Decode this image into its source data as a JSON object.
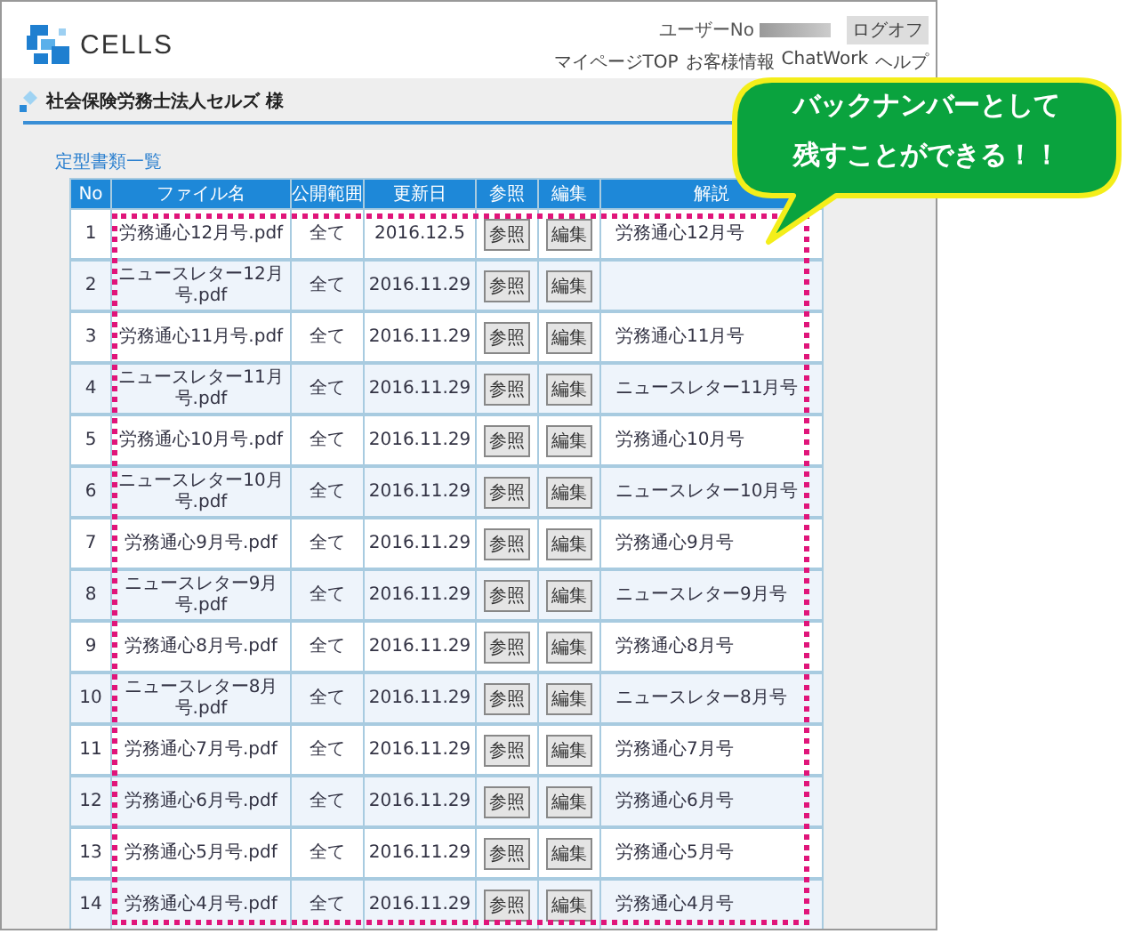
{
  "header": {
    "logo": "CELLS",
    "user_label": "ユーザーNo",
    "logout": "ログオフ",
    "nav": [
      "マイページTOP",
      "お客様情報",
      "ChatWork",
      "ヘルプ"
    ]
  },
  "client_name": "社会保険労務士法人セルズ 様",
  "section_title": "定型書類一覧",
  "table": {
    "columns": [
      "No",
      "ファイル名",
      "公開範囲",
      "更新日",
      "参照",
      "編集",
      "解説"
    ],
    "rows": [
      {
        "no": "1",
        "file": "労務通心12月号.pdf",
        "scope": "全て",
        "updated": "2016.12.5",
        "view": "参照",
        "edit": "編集",
        "note": "労務通心12月号"
      },
      {
        "no": "2",
        "file": "ニュースレター12月号.pdf",
        "scope": "全て",
        "updated": "2016.11.29",
        "view": "参照",
        "edit": "編集"
      },
      {
        "no": "3",
        "file": "労務通心11月号.pdf",
        "scope": "全て",
        "updated": "2016.11.29",
        "view": "参照",
        "edit": "編集",
        "note": "労務通心11月号"
      },
      {
        "no": "4",
        "file": "ニュースレター11月号.pdf",
        "scope": "全て",
        "updated": "2016.11.29",
        "view": "参照",
        "edit": "編集",
        "note": "ニュースレター11月号"
      },
      {
        "no": "5",
        "file": "労務通心10月号.pdf",
        "scope": "全て",
        "updated": "2016.11.29",
        "view": "参照",
        "edit": "編集",
        "note": "労務通心10月号"
      },
      {
        "no": "6",
        "file": "ニュースレター10月号.pdf",
        "scope": "全て",
        "updated": "2016.11.29",
        "view": "参照",
        "edit": "編集",
        "note": "ニュースレター10月号"
      },
      {
        "no": "7",
        "file": "労務通心9月号.pdf",
        "scope": "全て",
        "updated": "2016.11.29",
        "view": "参照",
        "edit": "編集",
        "note": "労務通心9月号"
      },
      {
        "no": "8",
        "file": "ニュースレター9月号.pdf",
        "scope": "全て",
        "updated": "2016.11.29",
        "view": "参照",
        "edit": "編集",
        "note": "ニュースレター9月号"
      },
      {
        "no": "9",
        "file": "労務通心8月号.pdf",
        "scope": "全て",
        "updated": "2016.11.29",
        "view": "参照",
        "edit": "編集",
        "note": "労務通心8月号"
      },
      {
        "no": "10",
        "file": "ニュースレター8月号.pdf",
        "scope": "全て",
        "updated": "2016.11.29",
        "view": "参照",
        "edit": "編集",
        "note": "ニュースレター8月号"
      },
      {
        "no": "11",
        "file": "労務通心7月号.pdf",
        "scope": "全て",
        "updated": "2016.11.29",
        "view": "参照",
        "edit": "編集",
        "note": "労務通心7月号"
      },
      {
        "no": "12",
        "file": "労務通心6月号.pdf",
        "scope": "全て",
        "updated": "2016.11.29",
        "view": "参照",
        "edit": "編集",
        "note": "労務通心6月号"
      },
      {
        "no": "13",
        "file": "労務通心5月号.pdf",
        "scope": "全て",
        "updated": "2016.11.29",
        "view": "参照",
        "edit": "編集",
        "note": "労務通心5月号"
      },
      {
        "no": "14",
        "file": "労務通心4月号.pdf",
        "scope": "全て",
        "updated": "2016.11.29",
        "view": "参照",
        "edit": "編集",
        "note": "労務通心4月号"
      }
    ]
  },
  "callout": {
    "lines": [
      "バックナンバーとして",
      "残すことができる！！"
    ]
  }
}
